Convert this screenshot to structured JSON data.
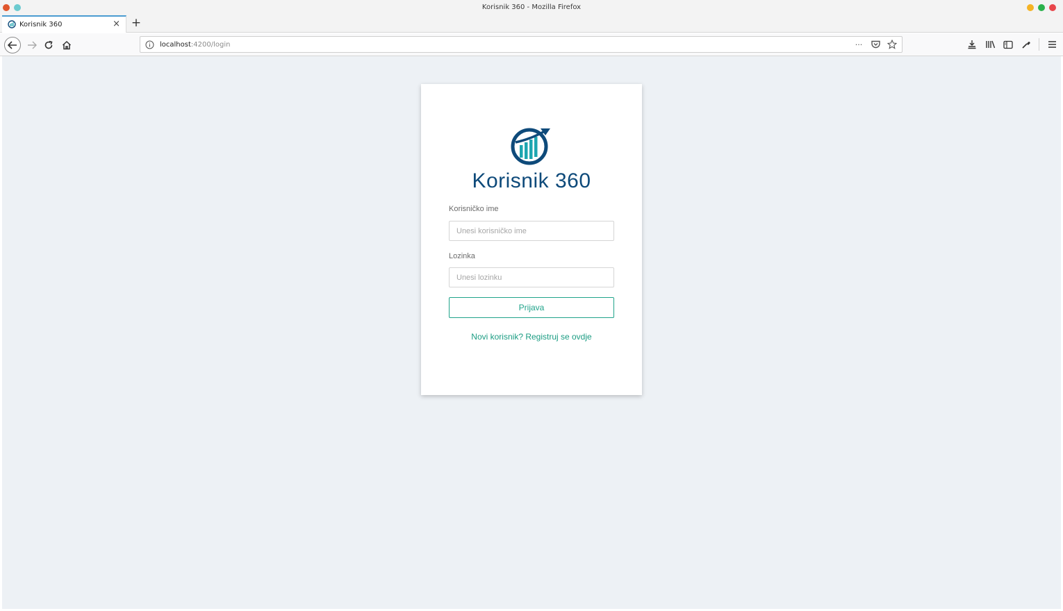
{
  "window": {
    "title": "Korisnik 360 - Mozilla Firefox",
    "traffic_colors": [
      "#f5a623",
      "#2bb24c",
      "#e8464b"
    ]
  },
  "tab": {
    "label": "Korisnik 360",
    "close_glyph": "×",
    "new_tab_glyph": "+"
  },
  "nav": {
    "url_host": "localhost",
    "url_path": ":4200/login",
    "more_glyph": "···"
  },
  "login": {
    "brand": "Korisnik 360",
    "username_label": "Korisničko ime",
    "username_placeholder": "Unesi korisničko ime",
    "password_label": "Lozinka",
    "password_placeholder": "Unesi lozinku",
    "submit_label": "Prijava",
    "register_text": "Novi korisnik? Registruj se ovdje"
  },
  "colors": {
    "brand_dark": "#0e4a7a",
    "accent_teal": "#1fa38a",
    "page_bg": "#edf1f5"
  },
  "icons": [
    "firefox-icon",
    "back-arrow-icon",
    "forward-arrow-icon",
    "reload-icon",
    "home-icon",
    "info-icon",
    "page-actions-icon",
    "pocket-icon",
    "bookmark-star-icon",
    "downloads-icon",
    "library-icon",
    "sidebar-icon",
    "eyedropper-icon",
    "hamburger-menu-icon",
    "chart-logo-icon"
  ]
}
